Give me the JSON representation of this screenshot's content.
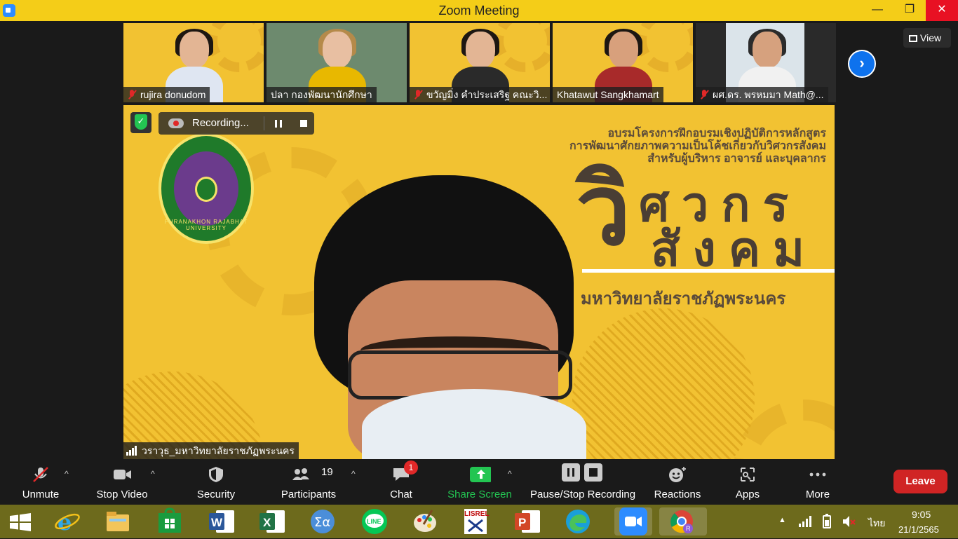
{
  "window": {
    "title": "Zoom Meeting",
    "minimize": "—",
    "maximize": "❐",
    "close": "✕"
  },
  "gallery": {
    "tiles": [
      {
        "name": "rujira donudom",
        "muted": true
      },
      {
        "name": "ปลา  กองพัฒนานักศึกษา",
        "muted": false
      },
      {
        "name": "ขวัญมิ่ง คำประเสริฐ คณะวิ...",
        "muted": true
      },
      {
        "name": "Khatawut Sangkhamart",
        "muted": false
      },
      {
        "name": "ผศ.ดร. พรหมมา Math@...",
        "muted": true
      }
    ],
    "next": "›",
    "view_label": "View"
  },
  "main_video": {
    "recording_label": "Recording...",
    "speaker_name": "วราวุธ_มหาวิทยาลัยราชภัฏพระนคร",
    "banner": {
      "line1": "อบรมโครงการฝึกอบรมเชิงปฏิบัติการหลักสูตร",
      "line2": "การพัฒนาศักยภาพความเป็นโค้ชเกี่ยวกับวิศวกรสังคม",
      "line3": "สำหรับผู้บริหาร อาจารย์ และบุคลากร",
      "big_vi": "วิ",
      "word1": "ศวกร",
      "word2": "สังคม",
      "university": "มหาวิทยาลัยราชภัฏพระนคร",
      "emblem_text": "PHRANAKHON RAJABHAT UNIVERSITY"
    }
  },
  "toolbar": {
    "unmute": "Unmute",
    "stop_video": "Stop Video",
    "security": "Security",
    "participants": "Participants",
    "participants_count": "19",
    "chat": "Chat",
    "chat_badge": "1",
    "share_screen": "Share Screen",
    "pause_stop_recording": "Pause/Stop Recording",
    "reactions": "Reactions",
    "apps": "Apps",
    "more": "More",
    "leave": "Leave",
    "caret": "^"
  },
  "taskbar": {
    "language": "ไทย",
    "time": "9:05",
    "date": "21/1/2565",
    "tray_expand": "▲"
  },
  "colors": {
    "accent_yellow": "#f4cd18",
    "zoom_blue": "#0e72ed",
    "share_green": "#23c552",
    "leave_red": "#d02424"
  }
}
